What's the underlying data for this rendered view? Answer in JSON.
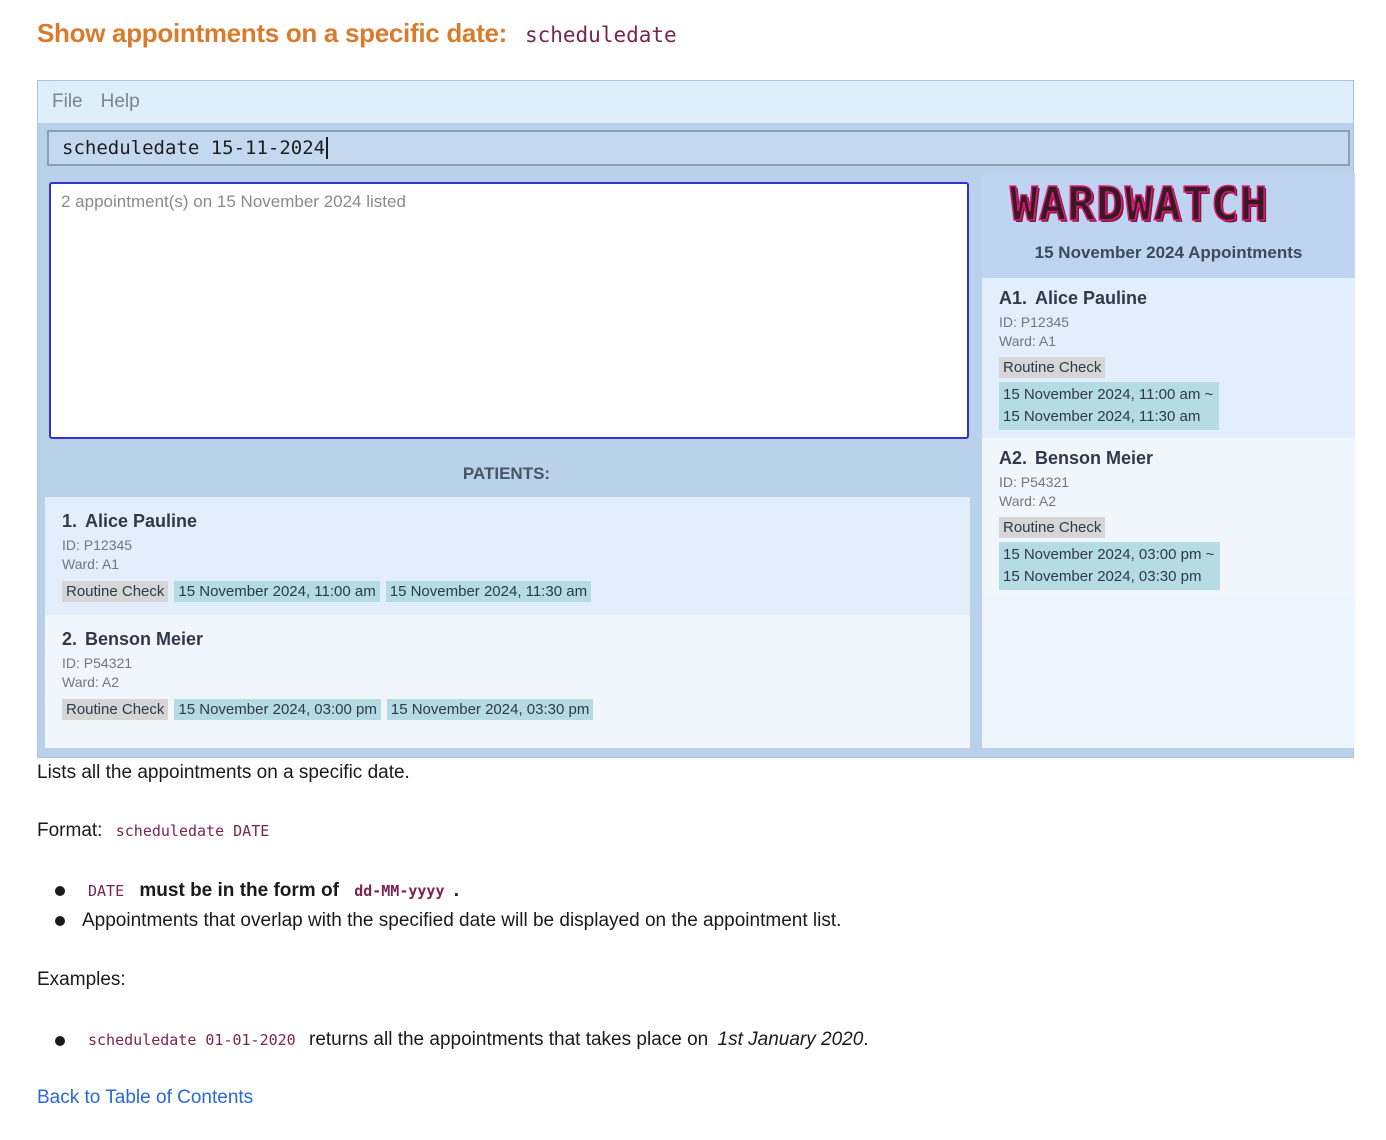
{
  "heading": {
    "text": "Show appointments on a specific date:",
    "code": "scheduledate"
  },
  "app": {
    "menu": [
      "File",
      "Help"
    ],
    "command_input": "scheduledate 15-11-2024",
    "result_text": "2 appointment(s) on 15 November 2024 listed",
    "patients_header": "PATIENTS:",
    "patients": [
      {
        "num": "1.",
        "name": "Alice Pauline",
        "id": "ID: P12345",
        "ward": "Ward: A1",
        "type": "Routine Check",
        "start": "15 November 2024, 11:00 am",
        "end": "15 November 2024, 11:30 am"
      },
      {
        "num": "2.",
        "name": "Benson Meier",
        "id": "ID: P54321",
        "ward": "Ward: A2",
        "type": "Routine Check",
        "start": "15 November 2024, 03:00 pm",
        "end": "15 November 2024, 03:30 pm"
      }
    ],
    "logo": "WARDWATCH",
    "schedule_title": "15 November 2024 Appointments",
    "appointments": [
      {
        "num": "A1.",
        "name": "Alice Pauline",
        "id": "ID: P12345",
        "ward": "Ward: A1",
        "type": "Routine Check",
        "start": "15 November 2024, 11:00 am ~",
        "end": "15 November 2024, 11:30 am"
      },
      {
        "num": "A2.",
        "name": "Benson Meier",
        "id": "ID: P54321",
        "ward": "Ward: A2",
        "type": "Routine Check",
        "start": "15 November 2024, 03:00 pm ~",
        "end": "15 November 2024, 03:30 pm"
      }
    ]
  },
  "doc": {
    "description": "Lists all the appointments on a specific date.",
    "format_label": "Format:",
    "format_code": "scheduledate DATE",
    "bullet1_code": "DATE",
    "bullet1_bold": "must be in the form of",
    "bullet1_code2": "dd-MM-yyyy",
    "bullet1_end": ".",
    "bullet2": "Appointments that overlap with the specified date will be displayed on the appointment list.",
    "examples_label": "Examples:",
    "example_code": "scheduledate 01-01-2020",
    "example_text": "returns all the appointments that takes place on",
    "example_italic": "1st January 2020",
    "example_end": ".",
    "back_link": "Back to Table of Contents"
  }
}
